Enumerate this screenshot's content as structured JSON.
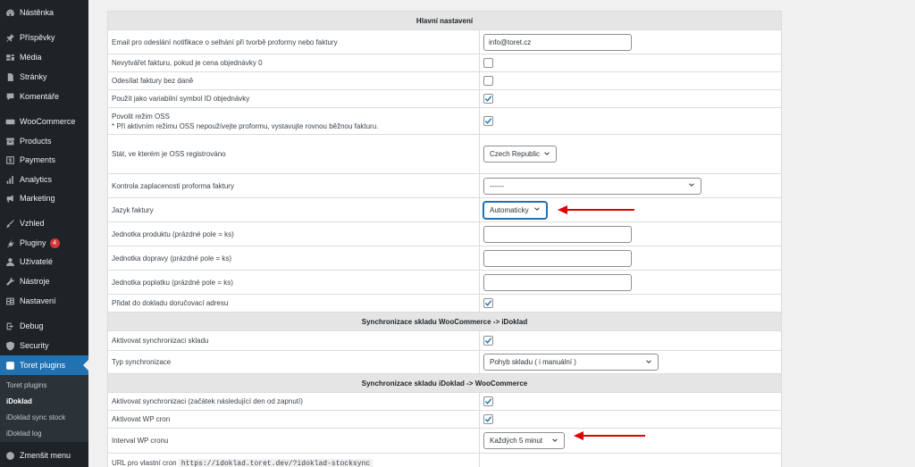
{
  "sidebar": {
    "items": [
      {
        "name": "dashboard",
        "label": "Nástěnka",
        "icon": "dashboard-icon"
      },
      {
        "name": "posts",
        "label": "Příspěvky",
        "icon": "pin-icon"
      },
      {
        "name": "media",
        "label": "Média",
        "icon": "media-icon"
      },
      {
        "name": "pages",
        "label": "Stránky",
        "icon": "page-icon"
      },
      {
        "name": "comments",
        "label": "Komentáře",
        "icon": "comment-icon"
      },
      {
        "name": "woocommerce",
        "label": "WooCommerce",
        "icon": "woo-icon"
      },
      {
        "name": "products",
        "label": "Products",
        "icon": "archive-icon"
      },
      {
        "name": "payments",
        "label": "Payments",
        "icon": "dollar-icon"
      },
      {
        "name": "analytics",
        "label": "Analytics",
        "icon": "bar-chart-icon"
      },
      {
        "name": "marketing",
        "label": "Marketing",
        "icon": "megaphone-icon"
      },
      {
        "name": "appearance",
        "label": "Vzhled",
        "icon": "brush-icon"
      },
      {
        "name": "plugins",
        "label": "Pluginy",
        "icon": "plug-icon",
        "badge": "4"
      },
      {
        "name": "users",
        "label": "Uživatelé",
        "icon": "user-icon"
      },
      {
        "name": "tools",
        "label": "Nástroje",
        "icon": "wrench-icon"
      },
      {
        "name": "settings",
        "label": "Nastavení",
        "icon": "settings-icon"
      },
      {
        "name": "debug",
        "label": "Debug",
        "icon": "debug-icon"
      },
      {
        "name": "security",
        "label": "Security",
        "icon": "shield-icon"
      },
      {
        "name": "toret-plugins",
        "label": "Toret plugins",
        "icon": "toret-icon"
      }
    ],
    "submenu": [
      {
        "name": "toret-plugins",
        "label": "Toret plugins"
      },
      {
        "name": "idoklad",
        "label": "iDoklad"
      },
      {
        "name": "idoklad-sync-stock",
        "label": "iDoklad sync stock"
      },
      {
        "name": "idoklad-log",
        "label": "iDoklad log"
      }
    ],
    "collapse_label": "Zmenšit menu"
  },
  "settings": {
    "main_header": "Hlavní nastavení",
    "email_label": "Email pro odeslání notifikace o selhání při tvorbě proformy nebo faktury",
    "email_value": "info@toret.cz",
    "no_invoice_zero_label": "Nevytvářet fakturu, pokud je cena objednávky 0",
    "no_tax_label": "Odesílat faktury bez daně",
    "variable_symbol_label": "Použít jako variabilní symbol ID objednávky",
    "oss_label": "Povolit režim OSS",
    "oss_note": "* Při aktivním režimu OSS nepoužívejte proformu, vystavujte rovnou běžnou fakturu.",
    "oss_country_label": "Stát, ve kterém je OSS registrováno",
    "oss_country_value": "Czech Republic",
    "proforma_check_label": "Kontrola zaplacenosti proforma faktury",
    "proforma_check_value": "------",
    "language_label": "Jazyk faktury",
    "language_value": "Automaticky",
    "product_unit_label": "Jednotka produktu (prázdné pole = ks)",
    "shipping_unit_label": "Jednotka dopravy (prázdné pole = ks)",
    "fee_unit_label": "Jednotka poplatku (prázdné pole = ks)",
    "delivery_address_label": "Přidat do dokladu doručovací adresu",
    "sync_wc_header": "Synchronizace skladu WooCommerce -> iDoklad",
    "sync_wc_enable_label": "Aktivovat synchronizaci skladu",
    "sync_type_label": "Typ synchronizace",
    "sync_type_value": "Pohyb skladu ( i manuální )",
    "sync_id_header": "Synchronizace skladu iDoklad -> WooCommerce",
    "sync_id_enable_label": "Aktivovat synchronizaci (začátek následující den od zapnutí)",
    "wp_cron_label": "Aktivovat WP cron",
    "cron_interval_label": "Interval WP cronu",
    "cron_interval_value": "Každých 5 minut",
    "cron_url_label": "URL pro vlastní cron",
    "cron_url_value": "https://idoklad.toret.dev/?idoklad-stocksync"
  },
  "colors": {
    "sidebar_bg": "#1d2327",
    "active_item": "#2271b1",
    "checkbox_check": "#2271b1",
    "annotation_arrow": "#e00000"
  }
}
